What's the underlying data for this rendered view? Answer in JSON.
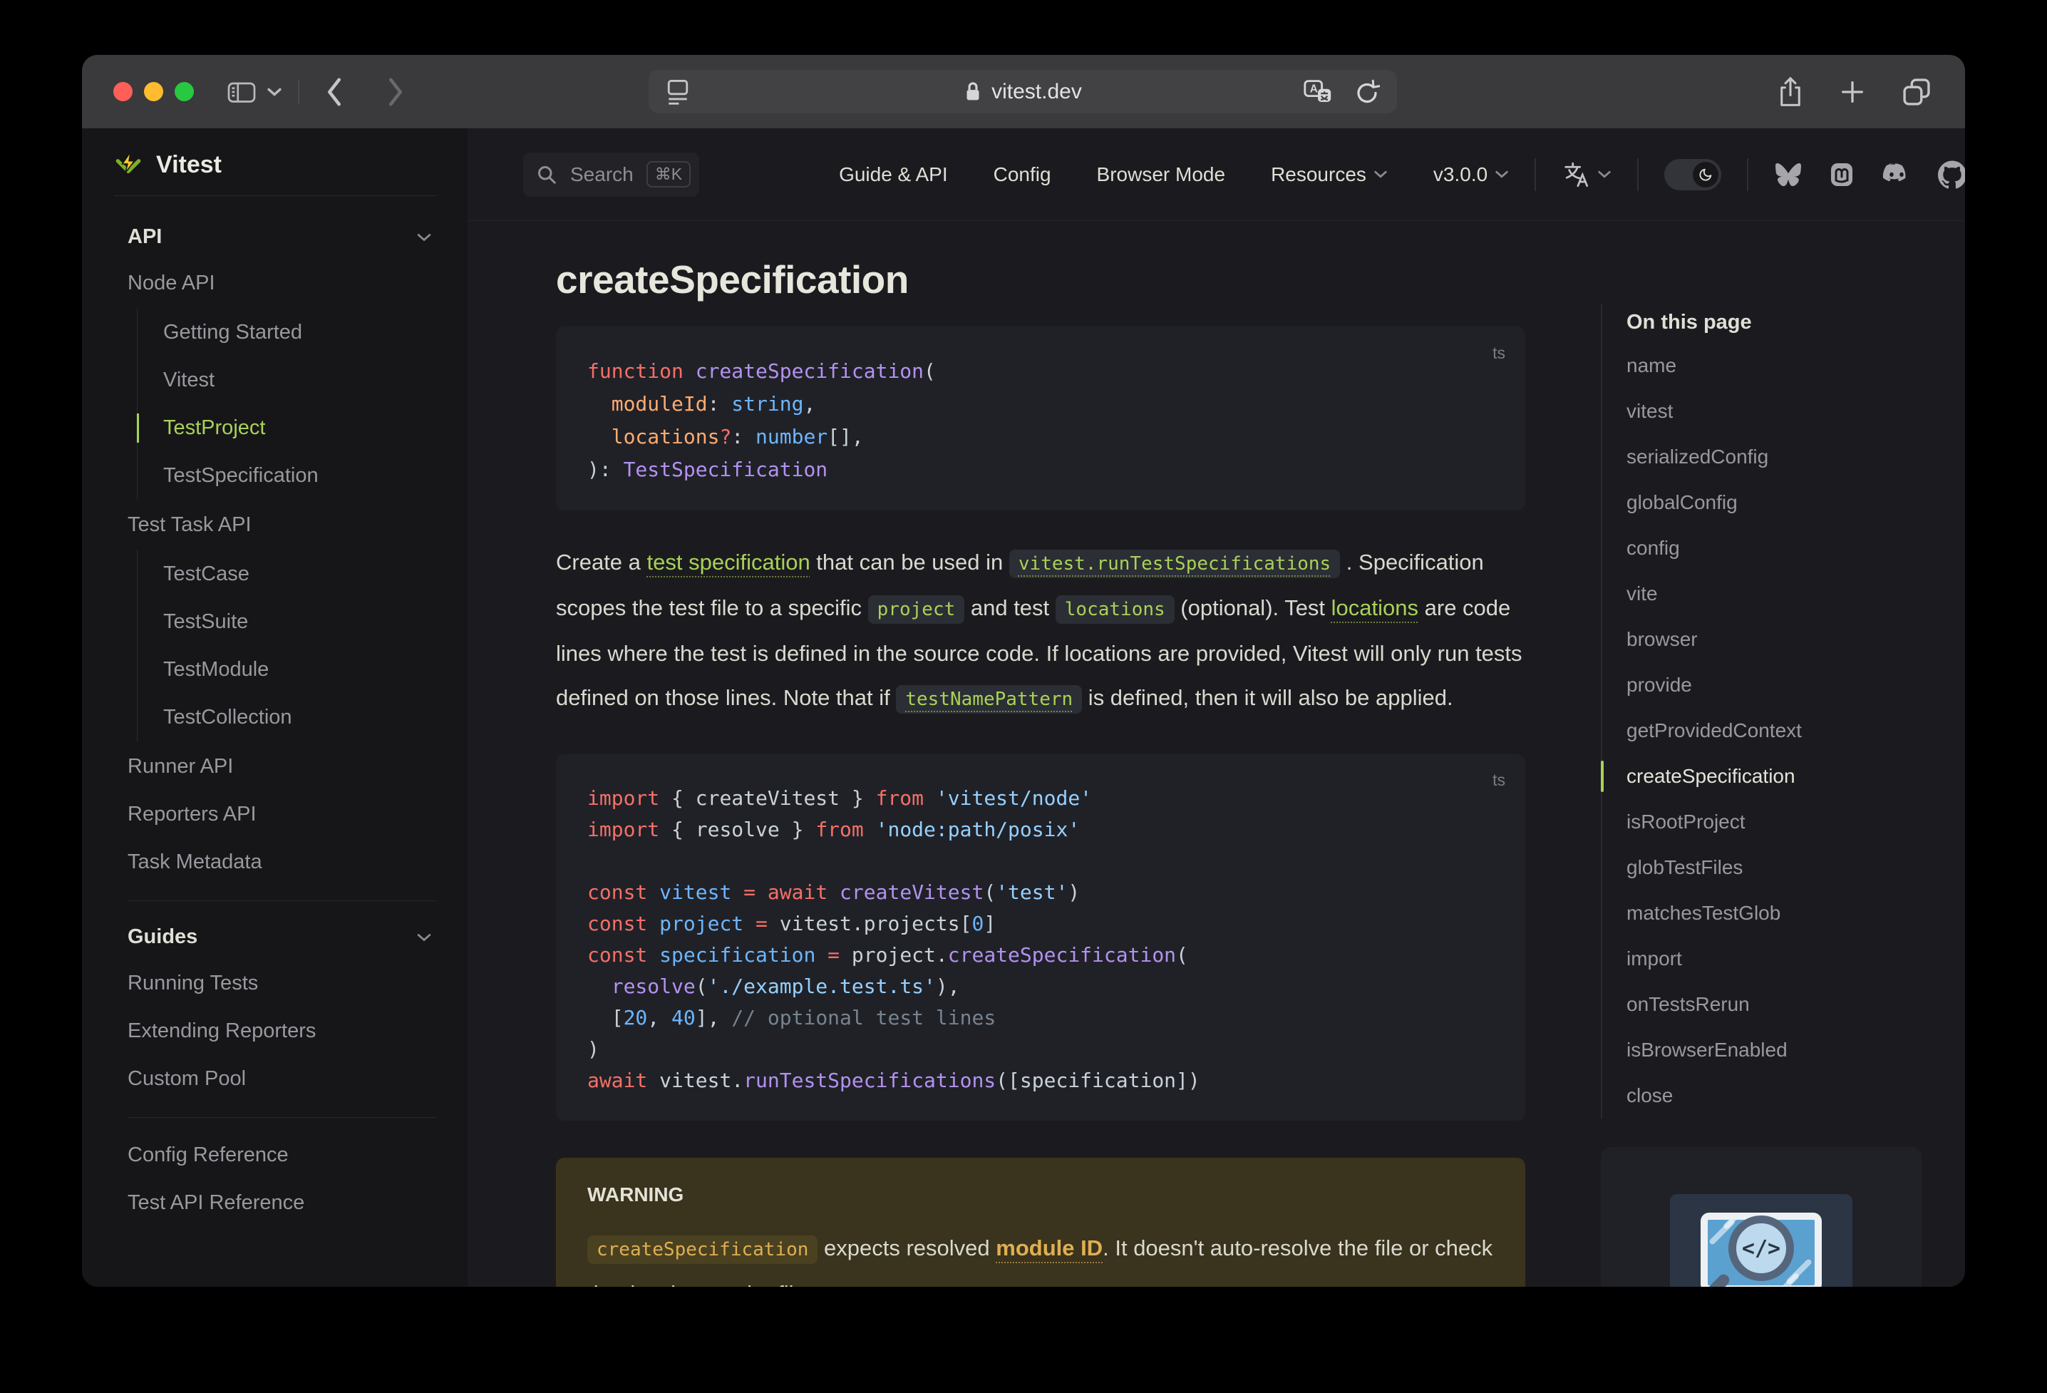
{
  "browser": {
    "url": "vitest.dev",
    "traffic_lights": {
      "close": "#ff5f57",
      "minimize": "#febc2e",
      "zoom": "#28c840"
    }
  },
  "nav": {
    "search_label": "Search",
    "search_kbd": "⌘K",
    "links": [
      {
        "label": "Guide & API"
      },
      {
        "label": "Config"
      },
      {
        "label": "Browser Mode"
      },
      {
        "label": "Resources",
        "chevron": true
      },
      {
        "label": "v3.0.0",
        "chevron": true
      }
    ]
  },
  "sidebar": {
    "logo_text": "Vitest",
    "api_header": "API",
    "node_api_label": "Node API",
    "node_api_items": [
      {
        "label": "Getting Started"
      },
      {
        "label": "Vitest"
      },
      {
        "label": "TestProject",
        "active": true
      },
      {
        "label": "TestSpecification"
      }
    ],
    "test_task_label": "Test Task API",
    "test_task_items": [
      {
        "label": "TestCase"
      },
      {
        "label": "TestSuite"
      },
      {
        "label": "TestModule"
      },
      {
        "label": "TestCollection"
      }
    ],
    "links_after": [
      {
        "label": "Runner API"
      },
      {
        "label": "Reporters API"
      },
      {
        "label": "Task Metadata"
      }
    ],
    "guides_header": "Guides",
    "guides_items": [
      {
        "label": "Running Tests"
      },
      {
        "label": "Extending Reporters"
      },
      {
        "label": "Custom Pool"
      }
    ],
    "reference_items": [
      {
        "label": "Config Reference"
      },
      {
        "label": "Test API Reference"
      }
    ]
  },
  "main": {
    "title": "createSpecification",
    "code1": {
      "lang": "ts",
      "lines": [
        [
          {
            "c": "k",
            "t": "function"
          },
          {
            "c": "w",
            "t": " "
          },
          {
            "c": "f",
            "t": "createSpecification"
          },
          {
            "c": "w",
            "t": "("
          }
        ],
        [
          {
            "c": "w",
            "t": "  "
          },
          {
            "c": "p",
            "t": "moduleId"
          },
          {
            "c": "w",
            "t": ": "
          },
          {
            "c": "t",
            "t": "string"
          },
          {
            "c": "w",
            "t": ","
          }
        ],
        [
          {
            "c": "w",
            "t": "  "
          },
          {
            "c": "p",
            "t": "locations"
          },
          {
            "c": "k",
            "t": "?"
          },
          {
            "c": "w",
            "t": ": "
          },
          {
            "c": "t",
            "t": "number"
          },
          {
            "c": "w",
            "t": "[],"
          }
        ],
        [
          {
            "c": "w",
            "t": "): "
          },
          {
            "c": "f",
            "t": "TestSpecification"
          }
        ]
      ]
    },
    "paragraph": [
      {
        "c": "t",
        "t": "Create a "
      },
      {
        "c": "link",
        "t": "test specification"
      },
      {
        "c": "t",
        "t": " that can be used in "
      },
      {
        "c": "codelink",
        "t": "vitest.runTestSpecifications"
      },
      {
        "c": "t",
        "t": " . Specification scopes the test file to a specific "
      },
      {
        "c": "code",
        "t": "project"
      },
      {
        "c": "t",
        "t": " and test "
      },
      {
        "c": "code",
        "t": "locations"
      },
      {
        "c": "t",
        "t": " (optional). Test "
      },
      {
        "c": "link",
        "t": "locations"
      },
      {
        "c": "t",
        "t": " are code lines where the test is defined in the source code. If locations are provided, Vitest will only run tests defined on those lines. Note that if "
      },
      {
        "c": "codelink",
        "t": "testNamePattern"
      },
      {
        "c": "t",
        "t": " is defined, then it will also be applied."
      }
    ],
    "code2": {
      "lang": "ts",
      "lines": [
        [
          {
            "c": "k",
            "t": "import"
          },
          {
            "c": "w",
            "t": " { createVitest } "
          },
          {
            "c": "k",
            "t": "from"
          },
          {
            "c": "w",
            "t": " "
          },
          {
            "c": "s",
            "t": "'vitest/node'"
          }
        ],
        [
          {
            "c": "k",
            "t": "import"
          },
          {
            "c": "w",
            "t": " { resolve } "
          },
          {
            "c": "k",
            "t": "from"
          },
          {
            "c": "w",
            "t": " "
          },
          {
            "c": "s",
            "t": "'node:path/posix'"
          }
        ],
        [],
        [
          {
            "c": "k",
            "t": "const"
          },
          {
            "c": "w",
            "t": " "
          },
          {
            "c": "v",
            "t": "vitest"
          },
          {
            "c": "w",
            "t": " "
          },
          {
            "c": "k",
            "t": "="
          },
          {
            "c": "w",
            "t": " "
          },
          {
            "c": "k",
            "t": "await"
          },
          {
            "c": "w",
            "t": " "
          },
          {
            "c": "f",
            "t": "createVitest"
          },
          {
            "c": "w",
            "t": "("
          },
          {
            "c": "s",
            "t": "'test'"
          },
          {
            "c": "w",
            "t": ")"
          }
        ],
        [
          {
            "c": "k",
            "t": "const"
          },
          {
            "c": "w",
            "t": " "
          },
          {
            "c": "v",
            "t": "project"
          },
          {
            "c": "w",
            "t": " "
          },
          {
            "c": "k",
            "t": "="
          },
          {
            "c": "w",
            "t": " vitest.projects["
          },
          {
            "c": "n",
            "t": "0"
          },
          {
            "c": "w",
            "t": "]"
          }
        ],
        [
          {
            "c": "k",
            "t": "const"
          },
          {
            "c": "w",
            "t": " "
          },
          {
            "c": "v",
            "t": "specification"
          },
          {
            "c": "w",
            "t": " "
          },
          {
            "c": "k",
            "t": "="
          },
          {
            "c": "w",
            "t": " project."
          },
          {
            "c": "f",
            "t": "createSpecification"
          },
          {
            "c": "w",
            "t": "("
          }
        ],
        [
          {
            "c": "w",
            "t": "  "
          },
          {
            "c": "f",
            "t": "resolve"
          },
          {
            "c": "w",
            "t": "("
          },
          {
            "c": "s",
            "t": "'./example.test.ts'"
          },
          {
            "c": "w",
            "t": "),"
          }
        ],
        [
          {
            "c": "w",
            "t": "  ["
          },
          {
            "c": "n",
            "t": "20"
          },
          {
            "c": "w",
            "t": ", "
          },
          {
            "c": "n",
            "t": "40"
          },
          {
            "c": "w",
            "t": "], "
          },
          {
            "c": "c",
            "t": "// optional test lines"
          }
        ],
        [
          {
            "c": "w",
            "t": ")"
          }
        ],
        [
          {
            "c": "k",
            "t": "await"
          },
          {
            "c": "w",
            "t": " vitest."
          },
          {
            "c": "f",
            "t": "runTestSpecifications"
          },
          {
            "c": "w",
            "t": "([specification])"
          }
        ]
      ]
    },
    "warning": {
      "title": "WARNING",
      "body": [
        {
          "c": "codewarn",
          "t": "createSpecification"
        },
        {
          "c": "t",
          "t": " expects resolved "
        },
        {
          "c": "warnlink",
          "t": "module ID"
        },
        {
          "c": "t",
          "t": ". It doesn't auto-resolve the file or check that it exists on the file system."
        }
      ]
    }
  },
  "outline": {
    "title": "On this page",
    "items": [
      {
        "label": "name"
      },
      {
        "label": "vitest"
      },
      {
        "label": "serializedConfig"
      },
      {
        "label": "globalConfig"
      },
      {
        "label": "config"
      },
      {
        "label": "vite"
      },
      {
        "label": "browser"
      },
      {
        "label": "provide"
      },
      {
        "label": "getProvidedContext"
      },
      {
        "label": "createSpecification",
        "active": true
      },
      {
        "label": "isRootProject"
      },
      {
        "label": "globTestFiles"
      },
      {
        "label": "matchesTestGlob"
      },
      {
        "label": "import"
      },
      {
        "label": "onTestsRerun"
      },
      {
        "label": "isBrowserEnabled"
      },
      {
        "label": "close"
      }
    ]
  },
  "ad": {
    "code_glyph": "</>"
  },
  "colors": {
    "brand": "#a9d158",
    "warning_accent": "#dfaf52"
  }
}
